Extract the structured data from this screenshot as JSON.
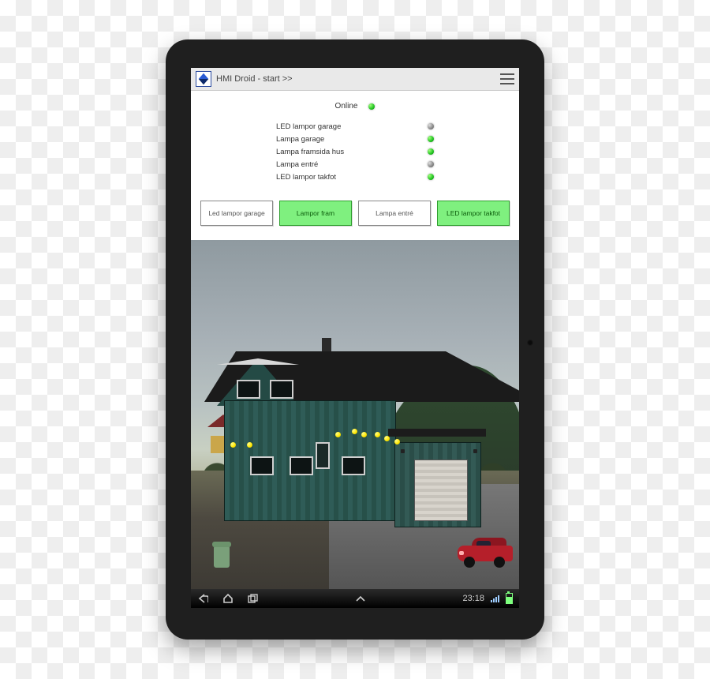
{
  "topbar": {
    "title": "HMI Droid - start >>"
  },
  "online": {
    "label": "Online",
    "state": "green"
  },
  "status": [
    {
      "name": "LED lampor garage",
      "state": "gray"
    },
    {
      "name": "Lampa garage",
      "state": "green"
    },
    {
      "name": "Lampa framsida hus",
      "state": "green"
    },
    {
      "name": "Lampa entré",
      "state": "gray"
    },
    {
      "name": "LED lampor takfot",
      "state": "green"
    }
  ],
  "buttons": [
    {
      "label": "Led lampor garage",
      "style": "white"
    },
    {
      "label": "Lampor fram",
      "style": "green"
    },
    {
      "label": "Lampa entré",
      "style": "white"
    },
    {
      "label": "LED lampor takfot",
      "style": "green"
    }
  ],
  "navbar": {
    "clock": "23:18"
  }
}
